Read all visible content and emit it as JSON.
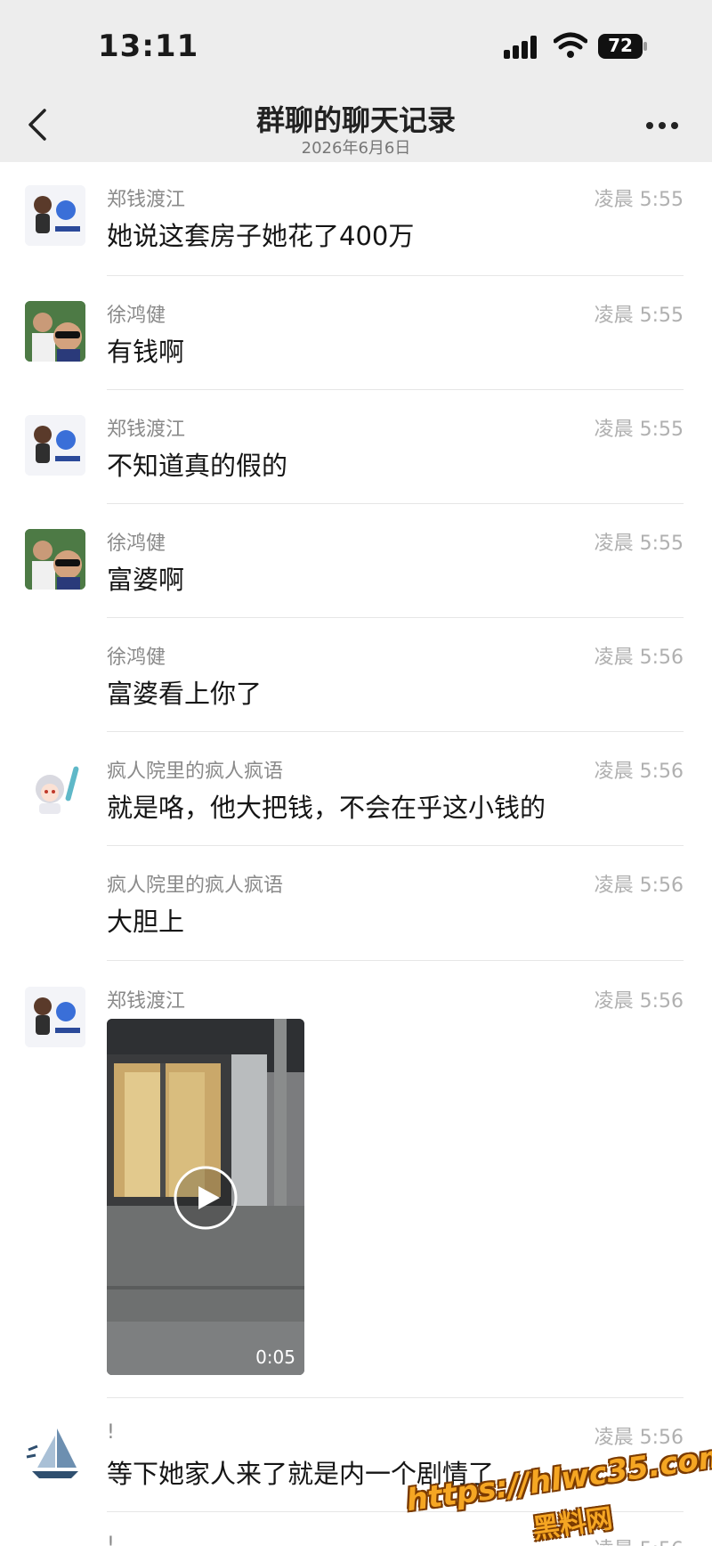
{
  "status": {
    "time": "13:11",
    "battery": "72"
  },
  "nav": {
    "title": "群聊的聊天记录",
    "subtitle": "2026年6月6日"
  },
  "messages": [
    {
      "sender": "郑钱渡江",
      "time": "凌晨 5:55",
      "text": "她说这套房子她花了400万"
    },
    {
      "sender": "徐鸿健",
      "time": "凌晨 5:55",
      "text": "有钱啊"
    },
    {
      "sender": "郑钱渡江",
      "time": "凌晨 5:55",
      "text": "不知道真的假的"
    },
    {
      "sender": "徐鸿健",
      "time": "凌晨 5:55",
      "text": "富婆啊"
    },
    {
      "sender": "徐鸿健",
      "time": "凌晨 5:56",
      "text": "富婆看上你了"
    },
    {
      "sender": "疯人院里的疯人疯语",
      "time": "凌晨 5:56",
      "text": "就是咯，他大把钱，不会在乎这小钱的"
    },
    {
      "sender": "疯人院里的疯人疯语",
      "time": "凌晨 5:56",
      "text": "大胆上"
    },
    {
      "sender": "郑钱渡江",
      "time": "凌晨 5:56",
      "video_duration": "0:05"
    },
    {
      "sender": "!",
      "time": "凌晨 5:56",
      "text": "等下她家人来了就是内一个剧情了"
    },
    {
      "sender": "!",
      "time": "凌晨 5:56"
    }
  ],
  "watermark": {
    "url": "https://hlwc35.com",
    "name": "黑料网"
  }
}
